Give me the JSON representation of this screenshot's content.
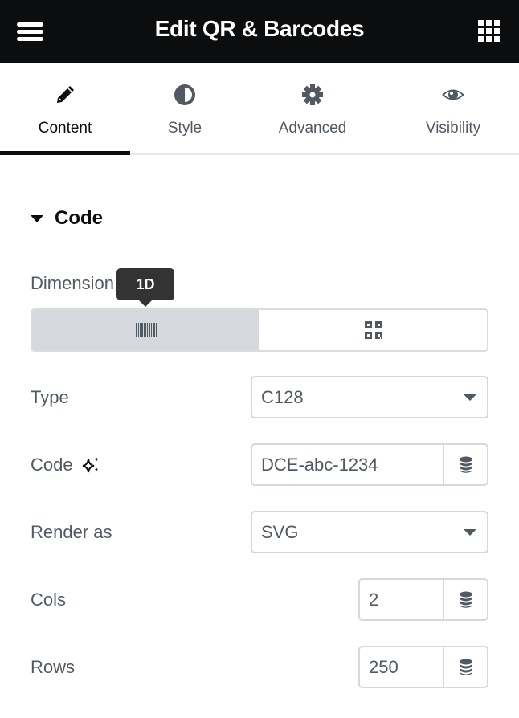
{
  "header": {
    "title": "Edit QR & Barcodes",
    "menu_icon": "hamburger-icon",
    "apps_icon": "grid-icon"
  },
  "tabs": [
    {
      "label": "Content",
      "icon": "pencil-icon",
      "active": true
    },
    {
      "label": "Style",
      "icon": "half-circle-icon",
      "active": false
    },
    {
      "label": "Advanced",
      "icon": "gear-icon",
      "active": false
    },
    {
      "label": "Visibility",
      "icon": "eye-icon",
      "active": false
    }
  ],
  "section": {
    "title": "Code",
    "expanded": true
  },
  "fields": {
    "dimension": {
      "label": "Dimension",
      "tooltip": "1D",
      "options": [
        {
          "value": "1D",
          "icon": "barcode-icon",
          "selected": true
        },
        {
          "value": "2D",
          "icon": "qr-code-icon",
          "selected": false
        }
      ]
    },
    "type": {
      "label": "Type",
      "value": "C128"
    },
    "code": {
      "label": "Code",
      "value": "DCE-abc-1234",
      "ai_icon": "sparkle-icon",
      "dynamic_icon": "database-icon"
    },
    "render_as": {
      "label": "Render as",
      "value": "SVG"
    },
    "cols": {
      "label": "Cols",
      "value": "2",
      "dynamic_icon": "database-icon"
    },
    "rows": {
      "label": "Rows",
      "value": "250",
      "dynamic_icon": "database-icon"
    }
  },
  "colors": {
    "header_bg": "#0c0d0e",
    "text": "#515962",
    "border": "#d5d8dc",
    "selected_bg": "#d5d8dc"
  }
}
